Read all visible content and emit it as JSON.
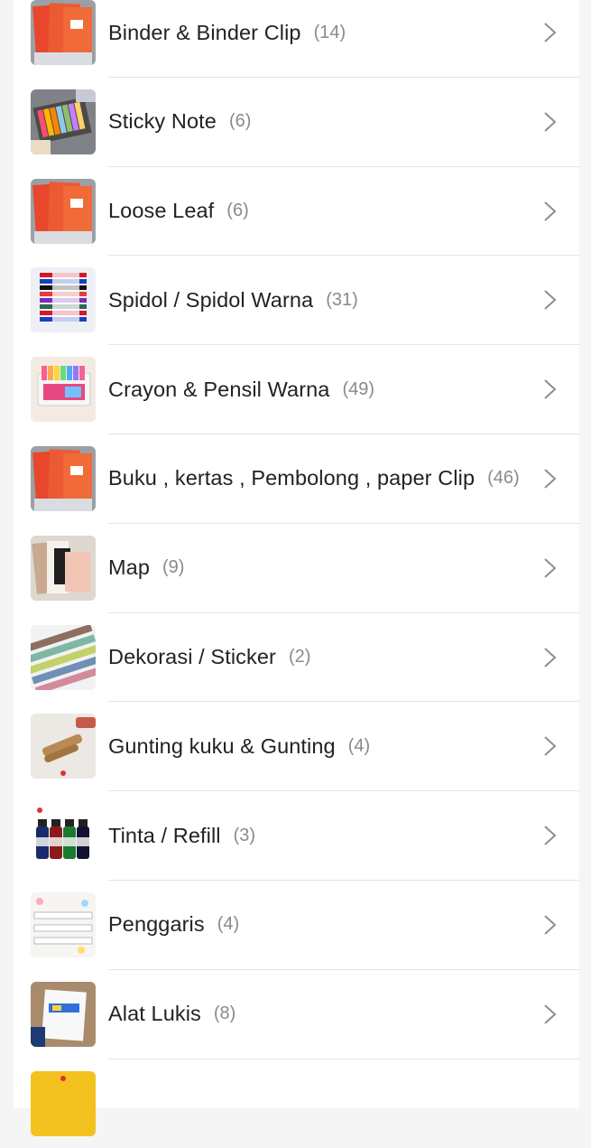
{
  "categories": [
    {
      "label": "Binder & Binder Clip",
      "count": "(14)",
      "thumb": "red-notebook-icon"
    },
    {
      "label": "Sticky Note",
      "count": "(6)",
      "thumb": "sticky-note-icon"
    },
    {
      "label": "Loose Leaf",
      "count": "(6)",
      "thumb": "red-notebook-icon"
    },
    {
      "label": "Spidol / Spidol Warna",
      "count": "(31)",
      "thumb": "marker-pens-icon"
    },
    {
      "label": "Crayon & Pensil Warna",
      "count": "(49)",
      "thumb": "crayon-box-icon"
    },
    {
      "label": "Buku , kertas , Pembolong , paper Clip",
      "count": "(46)",
      "thumb": "red-notebook-icon"
    },
    {
      "label": "Map",
      "count": "(9)",
      "thumb": "folder-map-icon"
    },
    {
      "label": "Dekorasi / Sticker",
      "count": "(2)",
      "thumb": "washi-tape-icon"
    },
    {
      "label": "Gunting kuku & Gunting",
      "count": "(4)",
      "thumb": "nail-clipper-icon"
    },
    {
      "label": "Tinta / Refill",
      "count": "(3)",
      "thumb": "ink-bottles-icon"
    },
    {
      "label": "Penggaris",
      "count": "(4)",
      "thumb": "ruler-icon"
    },
    {
      "label": "Alat Lukis",
      "count": "(8)",
      "thumb": "painting-tools-icon"
    },
    {
      "label": "",
      "count": "",
      "thumb": "yellow-item-icon"
    }
  ]
}
